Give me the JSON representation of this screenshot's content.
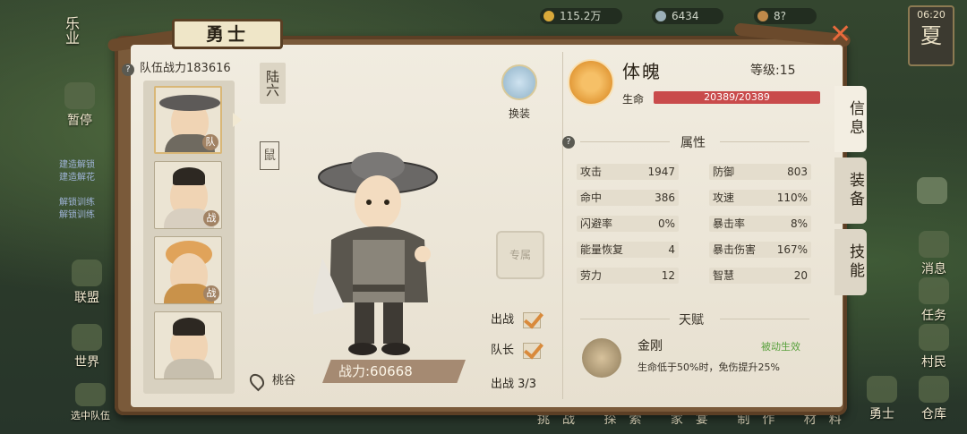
{
  "hud": {
    "resource_1": "115.2万",
    "resource_2": "6434",
    "resource_3": "8?",
    "clock_time": "06:20",
    "clock_season": "夏"
  },
  "left_menu": [
    "乐业",
    "暂停",
    "联盟",
    "世界",
    "选中队伍"
  ],
  "right_menu": [
    "消息",
    "任务",
    "村民",
    "勇士",
    "仓库"
  ],
  "task_list": [
    "建造解锁",
    "建造解花",
    "解锁训练",
    "解锁训练"
  ],
  "panel": {
    "title": "勇士",
    "team_power_label": "队伍战力",
    "team_power_value": "183616",
    "chapter": "陆六",
    "seal_char": "鼠",
    "roster": [
      {
        "tag": "队",
        "selected": true
      },
      {
        "tag": "战",
        "selected": false
      },
      {
        "tag": "战",
        "selected": false
      },
      {
        "tag": "",
        "selected": false
      }
    ],
    "location": "桃谷",
    "combat_power": "战力:60668",
    "outfit_label": "换装",
    "exclusive_label": "专属",
    "deploy_label": "出战",
    "captain_label": "队长",
    "deploy_count": "出战 3/3"
  },
  "info": {
    "class_name": "体魄",
    "level": "等级:15",
    "hp_label": "生命",
    "hp_value": "20389/20389",
    "hp_fraction": 1.0,
    "attributes_title": "属性",
    "attributes_left": [
      {
        "name": "攻击",
        "value": "1947"
      },
      {
        "name": "命中",
        "value": "386"
      },
      {
        "name": "闪避率",
        "value": "0%"
      },
      {
        "name": "能量恢复",
        "value": "4"
      },
      {
        "name": "劳力",
        "value": "12"
      }
    ],
    "attributes_right": [
      {
        "name": "防御",
        "value": "803"
      },
      {
        "name": "攻速",
        "value": "110%"
      },
      {
        "name": "暴击率",
        "value": "8%"
      },
      {
        "name": "暴击伤害",
        "value": "167%"
      },
      {
        "name": "智慧",
        "value": "20"
      }
    ],
    "talent_title": "天赋",
    "talent_name": "金刚",
    "talent_type": "被动生效",
    "talent_desc": "生命低于50%时，免伤提升25%"
  },
  "tabs": [
    "信息",
    "装备",
    "技能"
  ],
  "bottom_bar": "挑战 探索 家宴 制作 材料"
}
